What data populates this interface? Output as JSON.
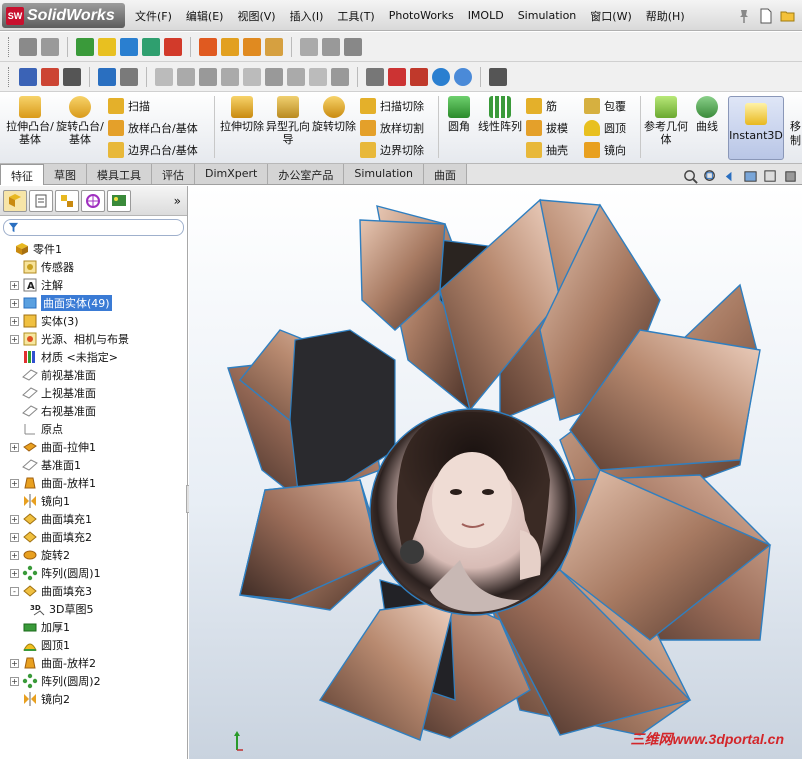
{
  "app": {
    "name": "SolidWorks",
    "logo_badge": "SW"
  },
  "menu": {
    "items": [
      "文件(F)",
      "编辑(E)",
      "视图(V)",
      "插入(I)",
      "工具(T)",
      "PhotoWorks",
      "IMOLD",
      "Simulation",
      "窗口(W)",
      "帮助(H)"
    ]
  },
  "command_manager": {
    "extrude_boss": "拉伸凸台/基体",
    "revolve_boss": "旋转凸台/基体",
    "sweep": "扫描",
    "loft_boss": "放样凸台/基体",
    "boundary_boss": "边界凸台/基体",
    "extrude_cut": "拉伸切除",
    "hole_wizard": "异型孔向导",
    "revolve_cut": "旋转切除",
    "swept_cut": "扫描切除",
    "lofted_cut": "放样切割",
    "boundary_cut": "边界切除",
    "fillet": "圆角",
    "linear_pattern": "线性阵列",
    "rib": "筋",
    "draft": "拔模",
    "shell": "抽壳",
    "wrap": "包覆",
    "dome": "圆顶",
    "mirror": "镜向",
    "ref_geometry": "参考几何体",
    "curves": "曲线",
    "instant3d": "Instant3D",
    "move_partial": "移",
    "move_partial_2": "制"
  },
  "tabs": [
    "特征",
    "草图",
    "模具工具",
    "评估",
    "DimXpert",
    "办公室产品",
    "Simulation",
    "曲面"
  ],
  "feature_tree": [
    {
      "label": "零件1",
      "icon": "part-icon",
      "expand": "",
      "indent": 0
    },
    {
      "label": "传感器",
      "icon": "sensor-icon",
      "expand": "",
      "indent": 1
    },
    {
      "label": "注解",
      "icon": "annotation-icon",
      "expand": "+",
      "indent": 1
    },
    {
      "label": "曲面实体(49)",
      "icon": "surface-body-icon",
      "expand": "+",
      "indent": 1,
      "selected": true
    },
    {
      "label": "实体(3)",
      "icon": "solid-body-icon",
      "expand": "+",
      "indent": 1
    },
    {
      "label": "光源、相机与布景",
      "icon": "lights-icon",
      "expand": "+",
      "indent": 1
    },
    {
      "label": "材质 <未指定>",
      "icon": "material-icon",
      "expand": "",
      "indent": 1
    },
    {
      "label": "前视基准面",
      "icon": "plane-icon",
      "expand": "",
      "indent": 1
    },
    {
      "label": "上视基准面",
      "icon": "plane-icon",
      "expand": "",
      "indent": 1
    },
    {
      "label": "右视基准面",
      "icon": "plane-icon",
      "expand": "",
      "indent": 1
    },
    {
      "label": "原点",
      "icon": "origin-icon",
      "expand": "",
      "indent": 1
    },
    {
      "label": "曲面-拉伸1",
      "icon": "surface-extrude-icon",
      "expand": "+",
      "indent": 1
    },
    {
      "label": "基准面1",
      "icon": "plane-icon",
      "expand": "",
      "indent": 1
    },
    {
      "label": "曲面-放样1",
      "icon": "surface-loft-icon",
      "expand": "+",
      "indent": 1
    },
    {
      "label": "镜向1",
      "icon": "mirror-icon",
      "expand": "",
      "indent": 1
    },
    {
      "label": "曲面填充1",
      "icon": "surface-fill-icon",
      "expand": "+",
      "indent": 1
    },
    {
      "label": "曲面填充2",
      "icon": "surface-fill-icon",
      "expand": "+",
      "indent": 1
    },
    {
      "label": "旋转2",
      "icon": "revolve-icon",
      "expand": "+",
      "indent": 1
    },
    {
      "label": "阵列(圆周)1",
      "icon": "circular-pattern-icon",
      "expand": "+",
      "indent": 1
    },
    {
      "label": "曲面填充3",
      "icon": "surface-fill-icon",
      "expand": "-",
      "indent": 1
    },
    {
      "label": "3D草图5",
      "icon": "sketch3d-icon",
      "expand": "",
      "indent": 2
    },
    {
      "label": "加厚1",
      "icon": "thicken-icon",
      "expand": "",
      "indent": 1
    },
    {
      "label": "圆顶1",
      "icon": "dome-icon",
      "expand": "",
      "indent": 1
    },
    {
      "label": "曲面-放样2",
      "icon": "surface-loft-icon",
      "expand": "+",
      "indent": 1
    },
    {
      "label": "阵列(圆周)2",
      "icon": "circular-pattern-icon",
      "expand": "+",
      "indent": 1
    },
    {
      "label": "镜向2",
      "icon": "mirror-icon",
      "expand": "",
      "indent": 1
    }
  ],
  "watermark": "三维网www.3dportal.cn",
  "colors": {
    "accent": "#3a7bd5",
    "petal_edge": "#2f7fc0",
    "petal_light": "#d8b5a0",
    "petal_dark": "#5a4036",
    "watermark": "#d3262a"
  }
}
